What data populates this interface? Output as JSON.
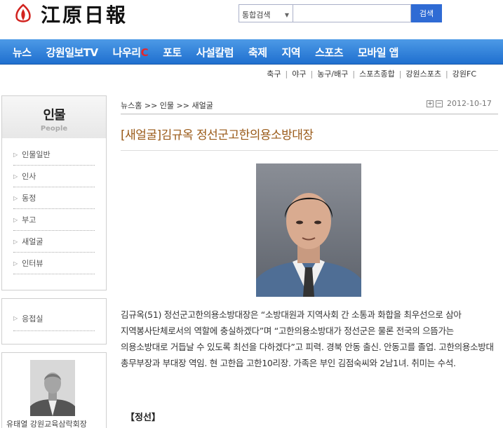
{
  "header": {
    "logo_text": "江原日報",
    "search": {
      "select_value": "통합검색",
      "input_value": "",
      "button_label": "검색"
    }
  },
  "main_nav": {
    "items": [
      "뉴스",
      "강원일보TV",
      "나우리",
      "포토",
      "사설칼럼",
      "축제",
      "지역",
      "스포츠",
      "모바일 앱"
    ],
    "nauri_suffix": "C"
  },
  "sub_nav": {
    "items": [
      "축구",
      "야구",
      "농구/배구",
      "스포츠종합",
      "강원스포츠",
      "강원FC"
    ]
  },
  "sidebar": {
    "title": "인물",
    "subtitle": "People",
    "items": [
      "인물일반",
      "인사",
      "동정",
      "부고",
      "새얼굴",
      "인터뷰"
    ],
    "extra_item": "응접실",
    "profile_caption": "유태열 강원교육삼락회장"
  },
  "article": {
    "breadcrumb": "뉴스홈 >> 인물 >> 새얼굴",
    "date": "2012-10-17",
    "title": "[새얼굴]김규옥 정선군고한의용소방대장",
    "body": "김규옥(51) 정선군고한의용소방대장은 “소방대원과 지역사회 간 소통과 화합을 최우선으로 삼아 지역봉사단체로서의 역할에 충실하겠다”며 “고한의용소방대가 정선군은 물론 전국의 으뜸가는 의용소방대로 거듭날 수 있도록 최선을 다하겠다”고 피력. 경북 안동 출신. 안동고를 졸업. 고한의용소방대 총무부장과 부대장 역임. 현 고한읍 고한10리장. 가족은 부인 김점숙씨와 2남1녀. 취미는 수석.",
    "region": "【정선】"
  },
  "colors": {
    "nav_top": "#4d9ae6",
    "nav_bottom": "#1f6fcf",
    "title": "#9a5a18",
    "search_button": "#2f6bd4",
    "logo_red": "#d2231f"
  }
}
